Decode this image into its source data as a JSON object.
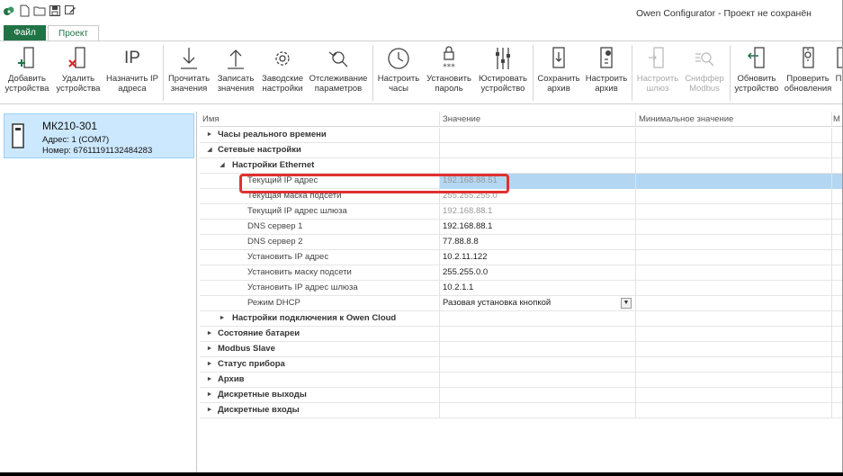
{
  "window": {
    "title": "Owen Configurator - Проект не сохранён"
  },
  "ribbon_tabs": [
    {
      "label": "Файл"
    },
    {
      "label": "Проект"
    }
  ],
  "ribbon_buttons": [
    {
      "line1": "Добавить",
      "line2": "устройства",
      "icon": "add-device-icon"
    },
    {
      "line1": "Удалить",
      "line2": "устройства",
      "icon": "remove-device-icon"
    },
    {
      "line1": "Назначить IP",
      "line2": "адреса",
      "icon": "ip-icon",
      "glyph": "IP"
    },
    {
      "line1": "Прочитать",
      "line2": "значения",
      "icon": "read-values-icon"
    },
    {
      "line1": "Записать",
      "line2": "значения",
      "icon": "write-values-icon"
    },
    {
      "line1": "Заводские",
      "line2": "настройки",
      "icon": "gear-icon"
    },
    {
      "line1": "Отслеживание",
      "line2": "параметров",
      "icon": "magnifier-icon"
    },
    {
      "line1": "Настроить",
      "line2": "часы",
      "icon": "clock-icon"
    },
    {
      "line1": "Установить",
      "line2": "пароль",
      "icon": "lock-icon"
    },
    {
      "line1": "Юстировать",
      "line2": "устройство",
      "icon": "sliders-icon"
    },
    {
      "line1": "Сохранить",
      "line2": "архив",
      "icon": "save-archive-icon"
    },
    {
      "line1": "Настроить",
      "line2": "архив",
      "icon": "archive-settings-icon"
    },
    {
      "line1": "Настроить",
      "line2": "шлюз",
      "icon": "gateway-icon"
    },
    {
      "line1": "Сниффер",
      "line2": "Modbus",
      "icon": "sniffer-icon"
    },
    {
      "line1": "Обновить",
      "line2": "устройство",
      "icon": "update-device-icon"
    },
    {
      "line1": "Проверить",
      "line2": "обновления",
      "icon": "check-updates-icon"
    },
    {
      "line1": "П",
      "line2": "",
      "icon": "more-icon"
    }
  ],
  "device": {
    "name": "МК210-301",
    "address": "Адрес: 1 (COM7)",
    "number": "Номер: 67611191132484283"
  },
  "grid": {
    "headers": {
      "name": "Имя",
      "value": "Значение",
      "min": "Минимальное значение",
      "max": "М"
    },
    "rows": [
      {
        "name": "Часы реального времени",
        "value": ""
      },
      {
        "name": "Сетевые настройки",
        "value": ""
      },
      {
        "name": "Настройки Ethernet",
        "value": ""
      },
      {
        "name": "Текущий IP адрес",
        "value": "192.168.88.51"
      },
      {
        "name": "Текущая маска подсети",
        "value": "255.255.255.0"
      },
      {
        "name": "Текущий IP адрес шлюза",
        "value": "192.168.88.1"
      },
      {
        "name": "DNS сервер 1",
        "value": "192.168.88.1"
      },
      {
        "name": "DNS сервер 2",
        "value": "77.88.8.8"
      },
      {
        "name": "Установить IP адрес",
        "value": "10.2.11.122"
      },
      {
        "name": "Установить маску подсети",
        "value": "255.255.0.0"
      },
      {
        "name": "Установить IP адрес шлюза",
        "value": "10.2.1.1"
      },
      {
        "name": "Режим DHCP",
        "value": "Разовая установка кнопкой"
      },
      {
        "name": "Настройки подключения к Owen Cloud",
        "value": ""
      },
      {
        "name": "Состояние батареи",
        "value": ""
      },
      {
        "name": "Modbus Slave",
        "value": ""
      },
      {
        "name": "Статус прибора",
        "value": ""
      },
      {
        "name": "Архив",
        "value": ""
      },
      {
        "name": "Дискретные выходы",
        "value": ""
      },
      {
        "name": "Дискретные входы",
        "value": ""
      }
    ]
  },
  "colors": {
    "accent": "#217346",
    "selection": "#b3d7f3",
    "device_selection": "#cce8ff",
    "highlight": "#e03131"
  }
}
